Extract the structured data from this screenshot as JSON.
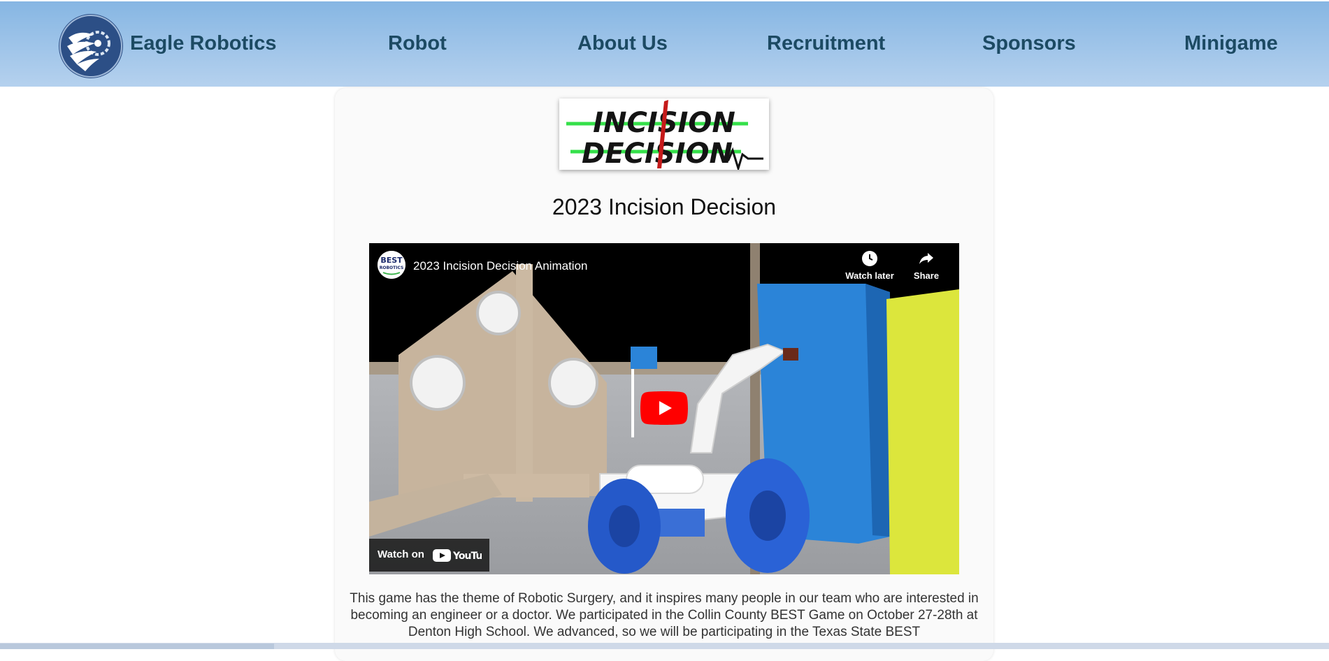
{
  "nav": {
    "brand": "Eagle Robotics",
    "links": [
      "Robot",
      "About Us",
      "Recruitment",
      "Sponsors",
      "Minigame"
    ]
  },
  "main": {
    "title": "2023 Incision Decision",
    "description": "This game has the theme of Robotic Surgery, and it inspires many people in our team who are interested in becoming an engineer or a doctor. We participated in the Collin County BEST Game on October 27-28th at Denton High School. We advanced, so we will be participating in the Texas State BEST"
  },
  "video": {
    "title": "2023 Incision Decision Animation",
    "watch_later": "Watch later",
    "share": "Share",
    "watch_on": "Watch on",
    "youtube": "YouTube"
  },
  "logo": {
    "game_logo_line1": "INCISION",
    "game_logo_line2": "DECISION",
    "avatar_text": "BEST ROBOTICS"
  },
  "colors": {
    "nav_text": "#1c4a63",
    "accent_red": "#ff0000",
    "logo_green": "#35e04a"
  }
}
